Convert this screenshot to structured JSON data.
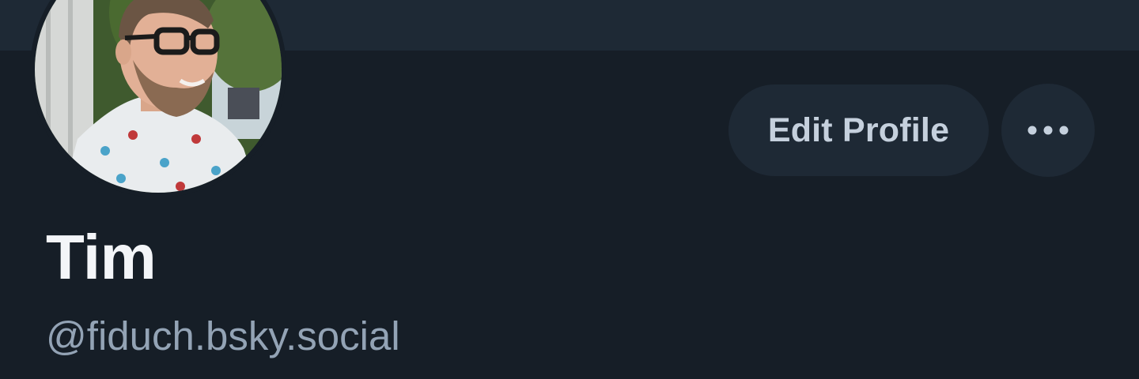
{
  "profile": {
    "display_name": "Tim",
    "handle": "@fiduch.bsky.social",
    "avatar_icon": "profile-photo"
  },
  "actions": {
    "edit_label": "Edit Profile",
    "more_icon": "ellipsis-icon"
  },
  "colors": {
    "background": "#161e27",
    "banner": "#1e2935",
    "button_bg": "#1e2935",
    "button_text": "#c5d0dd",
    "name_text": "#f3f5f8",
    "handle_text": "#93a3b5"
  }
}
